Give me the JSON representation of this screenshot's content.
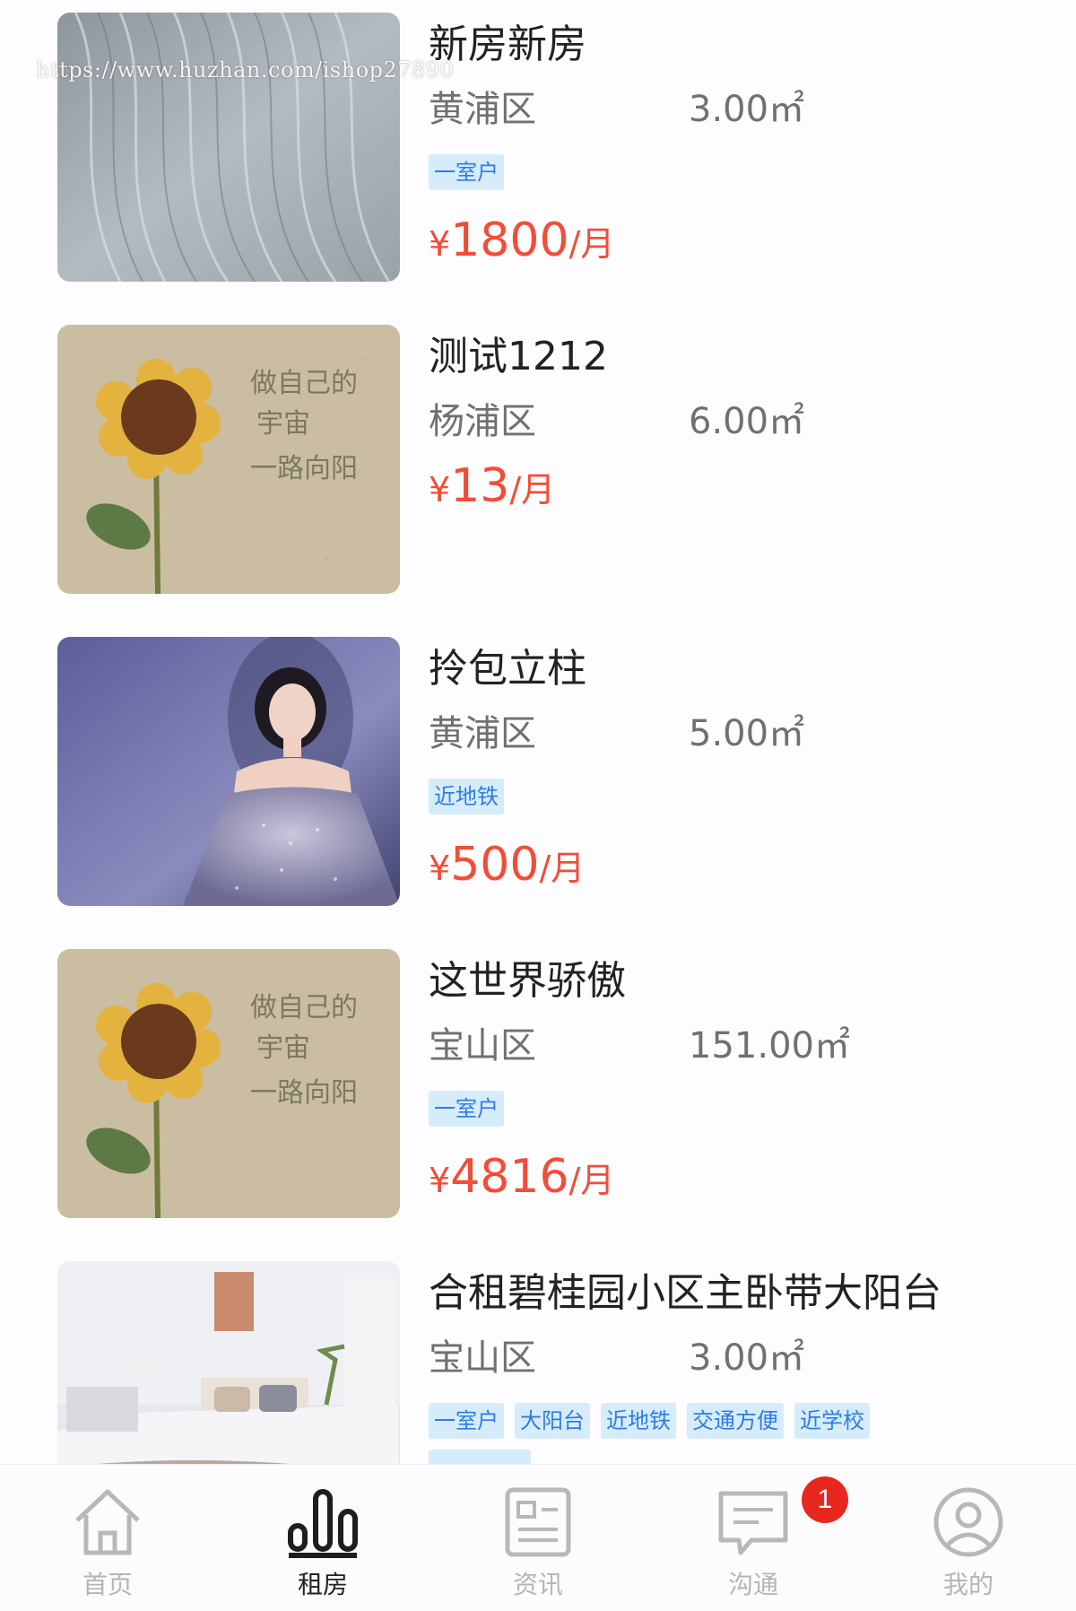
{
  "watermark": "https://www.huzhan.com/ishop27890",
  "listings": [
    {
      "title": "新房新房",
      "district": "黄浦区",
      "area": "3.00㎡",
      "tags": [
        "一室户"
      ],
      "price_symbol": "¥",
      "price": "1800",
      "price_unit": "/月",
      "image": "gray-fabric"
    },
    {
      "title": "测试1212",
      "district": "杨浦区",
      "area": "6.00㎡",
      "tags": [],
      "price_symbol": "¥",
      "price": "13",
      "price_unit": "/月",
      "image": "sunflower"
    },
    {
      "title": "拎包立柱",
      "district": "黄浦区",
      "area": "5.00㎡",
      "tags": [
        "近地铁"
      ],
      "price_symbol": "¥",
      "price": "500",
      "price_unit": "/月",
      "image": "woman-portrait"
    },
    {
      "title": "这世界骄傲",
      "district": "宝山区",
      "area": "151.00㎡",
      "tags": [
        "一室户"
      ],
      "price_symbol": "¥",
      "price": "4816",
      "price_unit": "/月",
      "image": "sunflower"
    },
    {
      "title": "合租碧桂园小区主卧带大阳台",
      "district": "宝山区",
      "area": "3.00㎡",
      "tags": [
        "一室户",
        "大阳台",
        "近地铁",
        "交通方便",
        "近学校"
      ],
      "image": "bedroom"
    }
  ],
  "tabbar": {
    "items": [
      {
        "label": "首页",
        "icon": "home-icon",
        "active": false
      },
      {
        "label": "租房",
        "icon": "bar-chart-icon",
        "active": true
      },
      {
        "label": "资讯",
        "icon": "news-icon",
        "active": false
      },
      {
        "label": "沟通",
        "icon": "chat-icon",
        "active": false
      },
      {
        "label": "我的",
        "icon": "user-icon",
        "active": false
      }
    ],
    "chat_badge": "1"
  },
  "colors": {
    "price": "#f24d37",
    "tag_text": "#2e7be6",
    "tag_bg": "#d6ecfb",
    "badge": "#e8281e"
  }
}
